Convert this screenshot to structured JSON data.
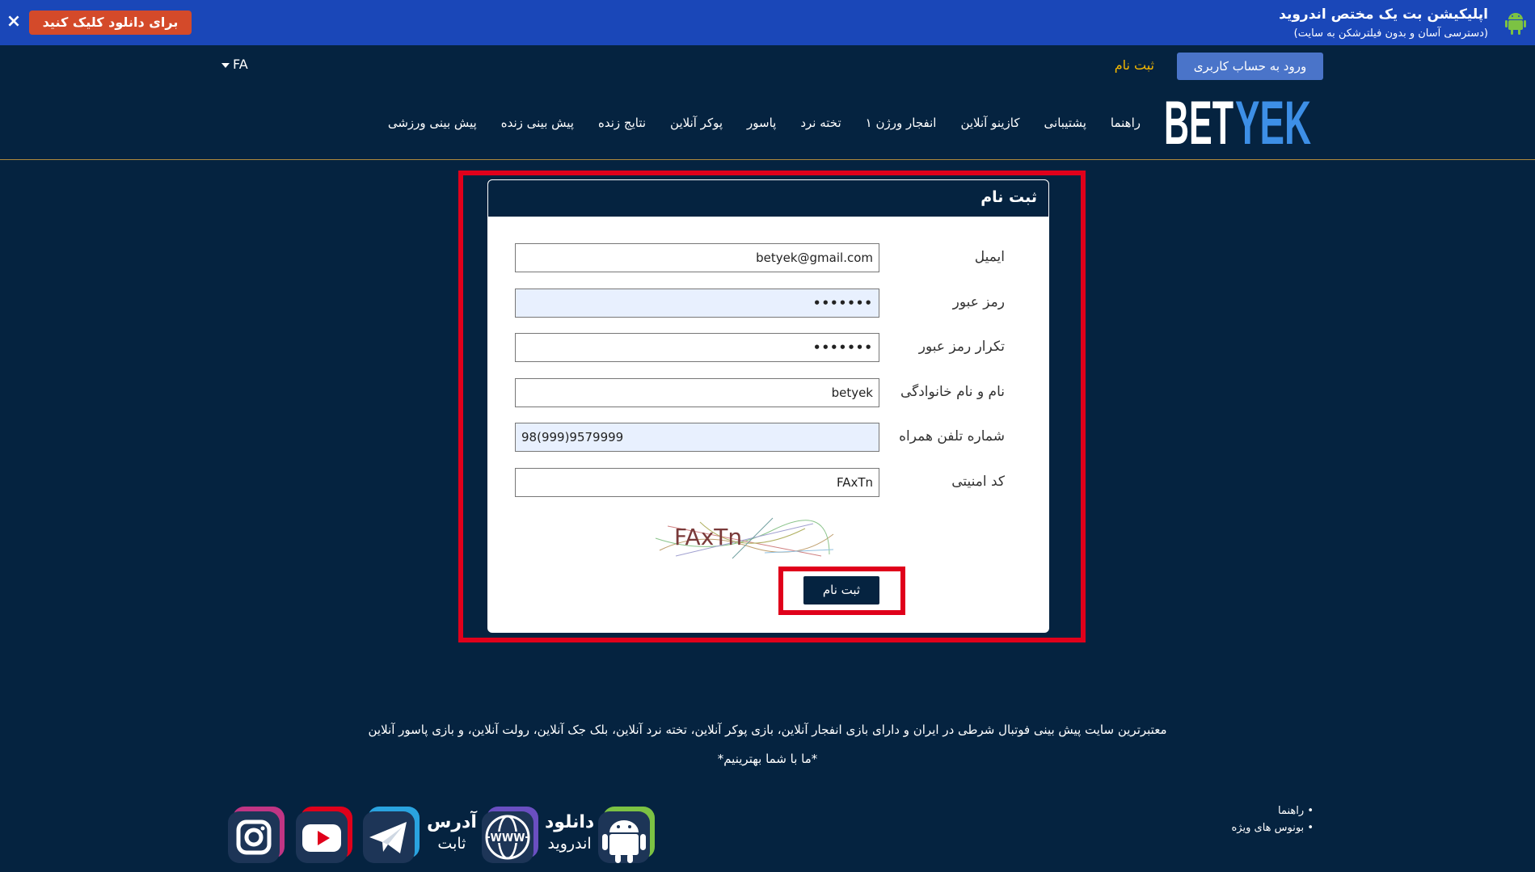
{
  "banner": {
    "title": "اپلیکیشن بت یک مختص اندروید",
    "subtitle": "(دسترسی آسان و بدون فیلترشکن به سایت)",
    "download_label": "برای دانلود کلیک کنید",
    "close_label": "×"
  },
  "header": {
    "language": "FA",
    "login_label": "ورود به حساب کاربری",
    "register_label": "ثبت نام",
    "logo": {
      "part1": "BET",
      "part2": "YEK"
    }
  },
  "nav": [
    "پیش بینی ورزشی",
    "پیش بینی زنده",
    "نتایج زنده",
    "پوکر آنلاین",
    "پاسور",
    "تخته نرد",
    "انفجار ورژن ۱",
    "کازینو آنلاین",
    "پشتیبانی",
    "راهنما"
  ],
  "form": {
    "title": "ثبت نام",
    "fields": {
      "email": {
        "label": "ایمیل",
        "value": "betyek@gmail.com"
      },
      "password": {
        "label": "رمز عبور",
        "value": "•••••••"
      },
      "password_confirm": {
        "label": "تکرار رمز عبور",
        "value": "•••••••"
      },
      "full_name": {
        "label": "نام و نام خانوادگی",
        "value": "betyek"
      },
      "phone": {
        "label": "شماره تلفن همراه",
        "value": "98(999)9579999"
      },
      "security_code": {
        "label": "کد امنیتی",
        "value": "FAxTn"
      }
    },
    "captcha_text": "FAxTn",
    "submit_label": "ثبت نام"
  },
  "footer": {
    "description": "معتبرترین سایت پیش بینی فوتبال شرطی در ایران و دارای بازی انفجار آنلاین، بازی پوکر آنلاین، تخته نرد آنلاین، بلک جک آنلاین، رولت آنلاین، و بازی پاسور آنلاین",
    "slogan": "*ما با شما بهترینیم*",
    "links": [
      "راهنما",
      "بونوس های ویژه"
    ],
    "download": {
      "line1": "دانلود",
      "line2": "اندروید"
    },
    "address": {
      "line1": "آدرس",
      "line2": "ثابت"
    },
    "www_label": "WWW"
  },
  "colors": {
    "background": "#052340",
    "banner": "#1a47b8",
    "download_button": "#d44a2a",
    "login_button": "#4a74c9",
    "register_link": "#f5b800",
    "highlight": "#e0001b",
    "logo_yek": "#3d8fe6"
  },
  "icons": {
    "banner": "android-icon",
    "social": [
      "instagram-icon",
      "youtube-icon",
      "telegram-icon",
      "www-globe-icon",
      "android-icon"
    ]
  }
}
